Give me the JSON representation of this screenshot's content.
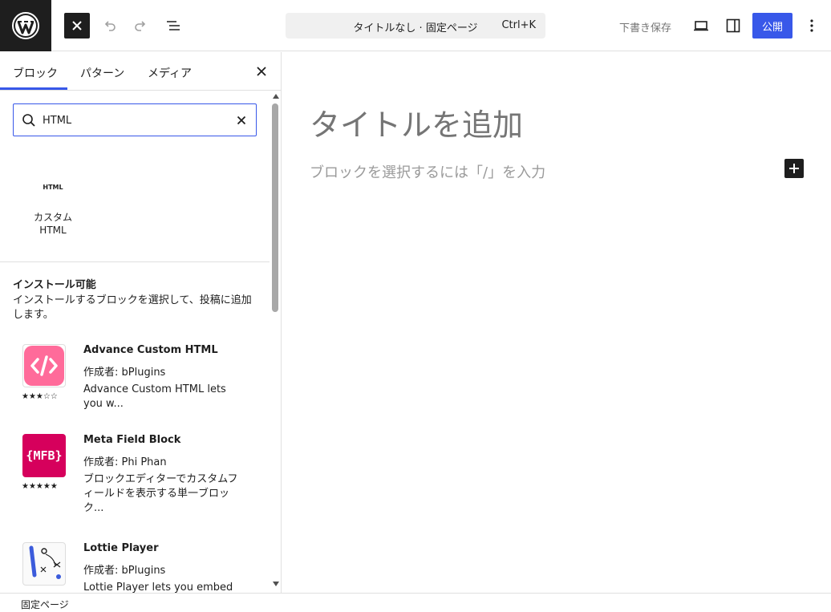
{
  "topbar": {
    "document_title": "タイトルなし · 固定ページ",
    "shortcut": "Ctrl+K",
    "save_draft": "下書き保存",
    "publish": "公開",
    "accent_color": "#3858e9"
  },
  "sidebar": {
    "tabs": [
      {
        "label": "ブロック",
        "active": true
      },
      {
        "label": "パターン",
        "active": false
      },
      {
        "label": "メディア",
        "active": false
      }
    ],
    "search": {
      "value": "HTML"
    },
    "result_block": {
      "icon_text": "HTML",
      "label_line1": "カスタム",
      "label_line2": "HTML"
    },
    "installable": {
      "title": "インストール可能",
      "description": "インストールするブロックを選択して、投稿に追加します。"
    },
    "plugins": [
      {
        "name": "Advance Custom HTML",
        "author": "作成者: bPlugins",
        "description": "Advance Custom HTML lets you w...",
        "rating": 3,
        "icon": "code-brackets-icon",
        "color": "#ff6b9a"
      },
      {
        "name": "Meta Field Block",
        "author": "作成者: Phi Phan",
        "description": "ブロックエディターでカスタムフィールドを表示する単一ブロック...",
        "rating": 5,
        "icon": "mfb-logo-icon",
        "icon_text": "{MFB}",
        "color": "#d6005c"
      },
      {
        "name": "Lottie Player",
        "author": "作成者: bPlugins",
        "description": "Lottie Player lets you embed a...",
        "rating": 0,
        "icon": "lottie-sketch-icon"
      }
    ]
  },
  "editor": {
    "title_placeholder": "タイトルを追加",
    "block_placeholder": "ブロックを選択するには「/」を入力"
  },
  "footer": {
    "breadcrumb": "固定ページ"
  }
}
